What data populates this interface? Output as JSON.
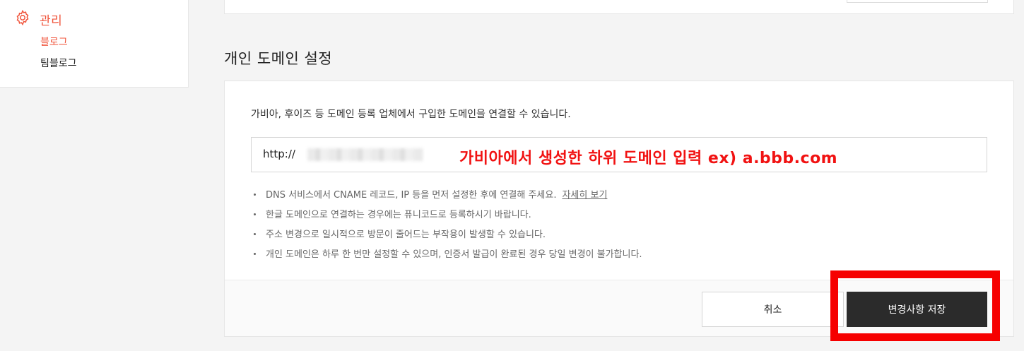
{
  "sidebar": {
    "section_label": "관리",
    "items": [
      {
        "label": "블로그",
        "active": true
      },
      {
        "label": "팀블로그",
        "active": false
      }
    ],
    "accent_color": "#f0533a"
  },
  "main": {
    "title": "개인 도메인 설정",
    "description": "가비아, 후이즈 등 도메인 등록 업체에서 구입한 도메인을 연결할 수 있습니다.",
    "domain_input": {
      "prefix": "http://",
      "value_blurred": true
    },
    "annotation": "가비아에서 생성한 하위 도메인 입력 ex) a.bbb.com",
    "notes": [
      {
        "text": "DNS 서비스에서 CNAME 레코드, IP 등을 먼저 설정한 후에 연결해 주세요.",
        "link": "자세히 보기"
      },
      {
        "text": "한글 도메인으로 연결하는 경우에는 퓨니코드로 등록하시기 바랍니다."
      },
      {
        "text": "주소 변경으로 일시적으로 방문이 줄어드는 부작용이 발생할 수 있습니다."
      },
      {
        "text": "개인 도메인은 하루 한 번만 설정할 수 있으며, 인증서 발급이 완료된 경우 당일 변경이 불가합니다."
      }
    ],
    "buttons": {
      "cancel": "취소",
      "save": "변경사항 저장"
    }
  },
  "colors": {
    "annotation_red": "#f11212",
    "highlight_red": "#f60000",
    "save_button_bg": "#2b2b2b"
  }
}
